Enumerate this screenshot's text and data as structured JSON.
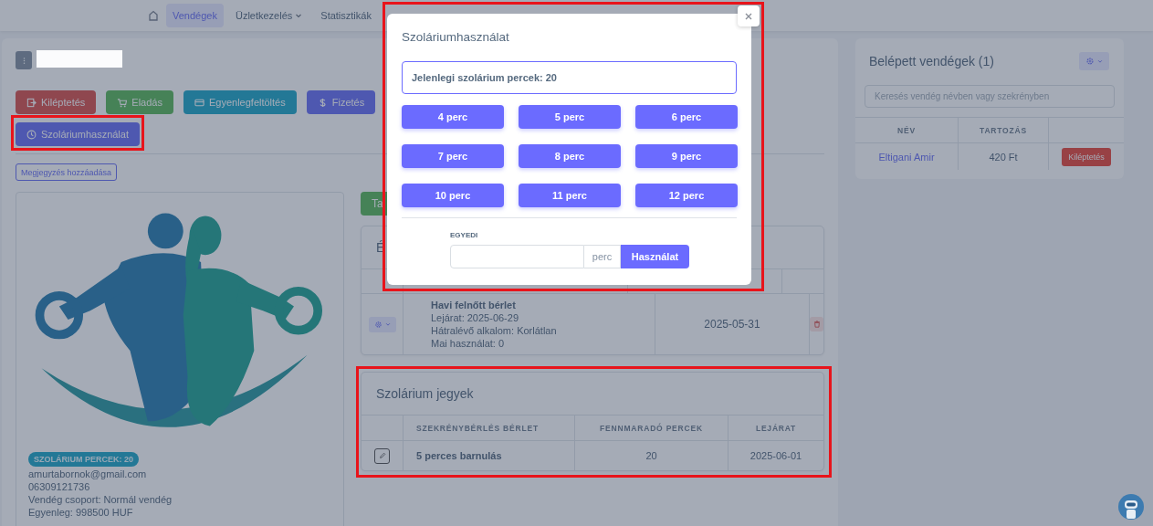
{
  "nav": {
    "items": [
      {
        "kind": "home",
        "selected": false
      },
      {
        "kind": "link",
        "label": "Vendégek",
        "selected": true
      },
      {
        "kind": "dropdown",
        "label": "Üzletkezelés",
        "selected": false
      },
      {
        "kind": "link",
        "label": "Statisztikák",
        "selected": false
      }
    ]
  },
  "guest": {
    "actions": [
      {
        "kind": "exit",
        "label": "Kiléptetés",
        "highlighted": false
      },
      {
        "kind": "cart",
        "label": "Eladás",
        "highlighted": false
      },
      {
        "kind": "card",
        "label": "Egyenlegfeltöltés",
        "highlighted": false
      },
      {
        "kind": "dollar",
        "label": "Fizetés",
        "highlighted": false
      },
      {
        "kind": "clock",
        "label": "Szoláriumhasználat",
        "highlighted": true
      }
    ],
    "note_button": "Megjegyzés hozzáadása",
    "profile": {
      "picture": {
        "kind": "picture"
      },
      "badge": "SZOLÁRIUM PERCEK: 20",
      "lines": [
        "amurtabornok@gmail.com",
        "06309121736",
        "Vendég csoport: Normál vendég",
        "Egyenleg: 998500 HUF"
      ]
    }
  },
  "passes_card": {
    "action_button": "Ta",
    "title": "É",
    "rows": [
      {
        "name": "Havi felnőtt bérlet",
        "details": [
          "Lejárat: 2025-06-29",
          "Hátralévő alkalom: Korlátlan",
          "Mai használat: 0"
        ],
        "date": "2025-05-31"
      }
    ]
  },
  "solarium_card": {
    "title": "Szolárium jegyek",
    "highlighted": true,
    "columns": [
      "SZEKRÉNYBÉRLÉS BÉRLET",
      "FENNMARADÓ PERCEK",
      "LEJÁRAT"
    ],
    "rows": [
      {
        "name": "5 perces barnulás",
        "minutes": "20",
        "expiry": "2025-06-01"
      }
    ]
  },
  "checked_in": {
    "title": "Belépett vendégek (1)",
    "search": {
      "placeholder": "Keresés vendég névben vagy szekrényben"
    },
    "columns": [
      "NÉV",
      "TARTOZÁS"
    ],
    "rows": [
      {
        "name": "Eltigani Amir",
        "debt": "420 Ft",
        "action": "Kiléptetés"
      }
    ]
  },
  "modal": {
    "title": "Szoláriumhasználat",
    "highlighted": true,
    "current": "Jelenlegi szolárium percek: 20",
    "options": [
      "4 perc",
      "5 perc",
      "6 perc",
      "7 perc",
      "8 perc",
      "9 perc",
      "10 perc",
      "11 perc",
      "12 perc"
    ],
    "custom": {
      "label": "EGYEDI",
      "unit": "perc",
      "submit": "Használat"
    }
  }
}
